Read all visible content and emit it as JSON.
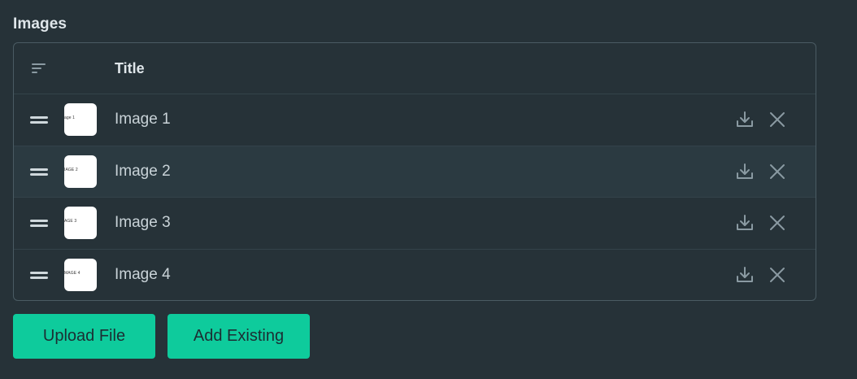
{
  "section": {
    "title": "Images"
  },
  "table": {
    "header": {
      "title_label": "Title",
      "sort_icon": "sort-lines-icon"
    },
    "rows": [
      {
        "title": "Image 1",
        "thumb_text": "age 1"
      },
      {
        "title": "Image 2",
        "thumb_text": "IAGE 2"
      },
      {
        "title": "Image 3",
        "thumb_text": "AGE 3"
      },
      {
        "title": "Image 4",
        "thumb_text": "MAGE 4"
      }
    ],
    "row_icons": {
      "drag": "drag-handle-icon",
      "download": "download-icon",
      "remove": "close-icon"
    }
  },
  "actions": {
    "upload_label": "Upload File",
    "add_existing_label": "Add Existing"
  },
  "colors": {
    "background": "#263238",
    "accent": "#0ecb9c",
    "border": "#4a5b63",
    "icon": "#8a9aa2"
  }
}
